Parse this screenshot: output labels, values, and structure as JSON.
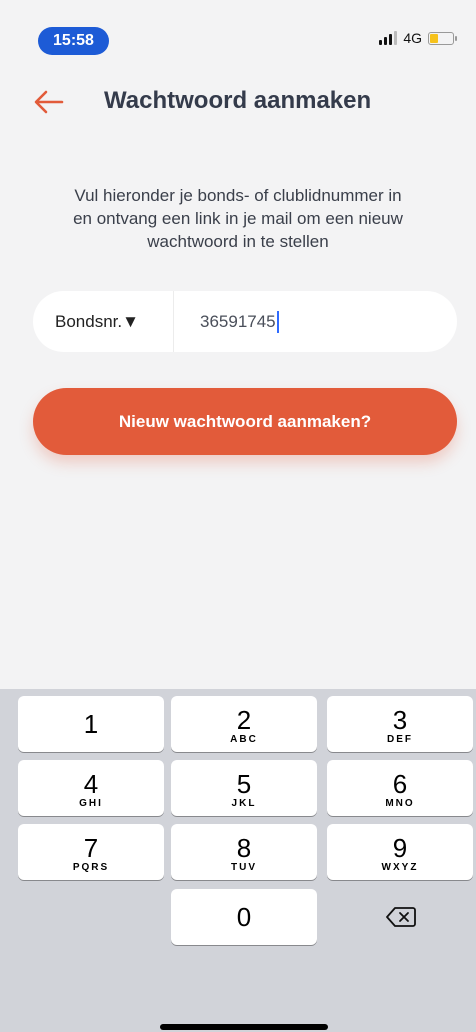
{
  "status_bar": {
    "time": "15:58",
    "network": "4G"
  },
  "header": {
    "title": "Wachtwoord aanmaken"
  },
  "instruction": {
    "line1": "Vul hieronder je bonds- of clublidnummer in",
    "line2": "en ontvang een link in je mail om een nieuw",
    "line3": "wachtwoord in te stellen"
  },
  "form": {
    "select_label": "Bondsnr.▼",
    "input_value": "36591745"
  },
  "button": {
    "label": "Nieuw wachtwoord aanmaken?"
  },
  "keyboard": {
    "keys": [
      {
        "num": "1",
        "letters": ""
      },
      {
        "num": "2",
        "letters": "ABC"
      },
      {
        "num": "3",
        "letters": "DEF"
      },
      {
        "num": "4",
        "letters": "GHI"
      },
      {
        "num": "5",
        "letters": "JKL"
      },
      {
        "num": "6",
        "letters": "MNO"
      },
      {
        "num": "7",
        "letters": "PQRS"
      },
      {
        "num": "8",
        "letters": "TUV"
      },
      {
        "num": "9",
        "letters": "WXYZ"
      },
      {
        "num": "0",
        "letters": ""
      }
    ]
  },
  "colors": {
    "accent": "#e25b3a",
    "time_pill": "#1d5bd6",
    "title": "#343b4b"
  }
}
